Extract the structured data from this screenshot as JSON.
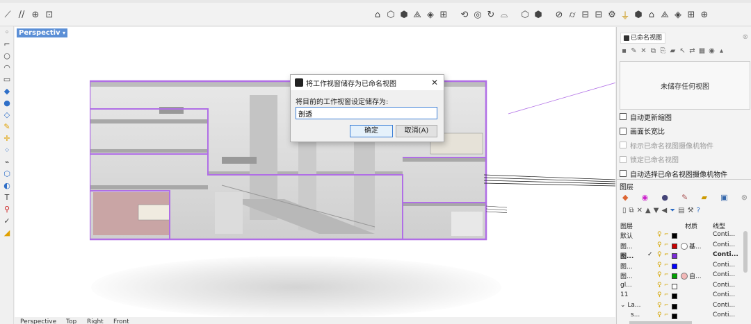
{
  "viewport": {
    "label": "Perspective"
  },
  "dialog": {
    "title": "将工作视窗储存为已命名视图",
    "prompt": "将目前的工作视窗设定储存为:",
    "value": "剖透",
    "ok": "确定",
    "cancel": "取消(A)"
  },
  "bottom_tabs": [
    "Perspective",
    "Top",
    "Right",
    "Front"
  ],
  "named_views": {
    "tab": "已命名视图",
    "empty": "未储存任何视图",
    "options": [
      {
        "label": "自动更新缩图",
        "enabled": true
      },
      {
        "label": "画面长宽比",
        "enabled": true
      },
      {
        "label": "标示已命名视图摄像机物件",
        "enabled": false
      },
      {
        "label": "锁定已命名视图",
        "enabled": false
      },
      {
        "label": "自动选择已命名视图摄像机物件",
        "enabled": true
      }
    ]
  },
  "layers": {
    "title": "图层",
    "columns": {
      "name": "图层",
      "material": "材质",
      "linetype": "线型"
    },
    "rows": [
      {
        "name": "默认",
        "color": "#000000",
        "material": "",
        "linetype": "Conti...",
        "current": false,
        "bold": false,
        "indent": false
      },
      {
        "name": "图...",
        "color": "#c80000",
        "material": "基...",
        "mat_color": "#ffffff",
        "linetype": "Conti...",
        "current": false,
        "bold": false,
        "indent": false
      },
      {
        "name": "图...",
        "color": "#7a2bd6",
        "material": "",
        "linetype": "Conti...",
        "current": true,
        "bold": true,
        "indent": false
      },
      {
        "name": "图...",
        "color": "#0000ff",
        "material": "",
        "linetype": "Conti...",
        "current": false,
        "bold": false,
        "indent": false
      },
      {
        "name": "图...",
        "color": "#00a000",
        "material": "自...",
        "mat_color": "#f2b8b8",
        "linetype": "Conti...",
        "current": false,
        "bold": false,
        "indent": false
      },
      {
        "name": "gl...",
        "color": "#ffffff",
        "material": "",
        "linetype": "Conti...",
        "current": false,
        "bold": false,
        "indent": false
      },
      {
        "name": "11",
        "color": "#000000",
        "material": "",
        "linetype": "Conti...",
        "current": false,
        "bold": false,
        "indent": false
      },
      {
        "name": "La...",
        "color": "#000000",
        "material": "",
        "linetype": "Conti...",
        "current": false,
        "bold": false,
        "indent": false,
        "expanded": true
      },
      {
        "name": "s...",
        "color": "#000000",
        "material": "",
        "linetype": "Conti...",
        "current": false,
        "bold": false,
        "indent": true
      }
    ]
  },
  "colors": {
    "accent": "#5b8fd6",
    "selection": "#b06ee6"
  }
}
